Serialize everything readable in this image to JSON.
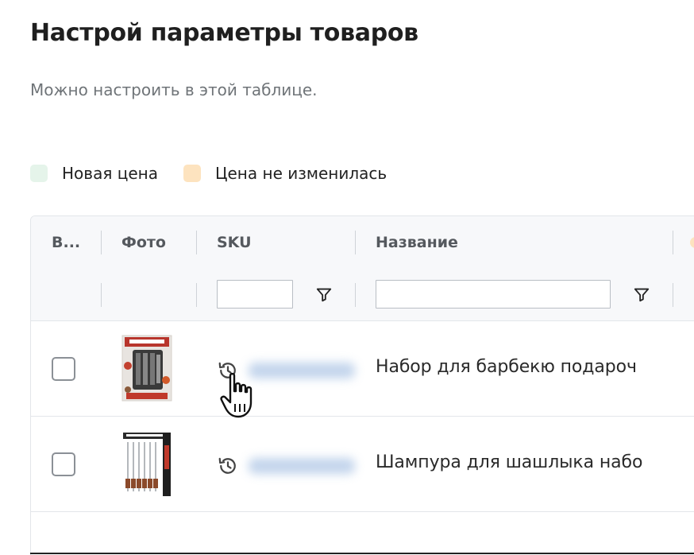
{
  "header": {
    "title": "Настрой параметры товаров",
    "subtitle": "Можно настроить в этой таблице."
  },
  "legend": [
    {
      "label": "Новая цена",
      "color": "#e5f4ea"
    },
    {
      "label": "Цена не изменилась",
      "color": "#fde3bf"
    }
  ],
  "table": {
    "columns": [
      "В...",
      "Фото",
      "SKU",
      "Название"
    ],
    "rows": [
      {
        "name": "Набор для барбекю подароч",
        "thumb": "bbq-set-box-image",
        "sku_icon": "history-icon"
      },
      {
        "name": "Шампура для шашлыка набо",
        "thumb": "skewers-set-image",
        "sku_icon": "history-icon"
      }
    ]
  }
}
